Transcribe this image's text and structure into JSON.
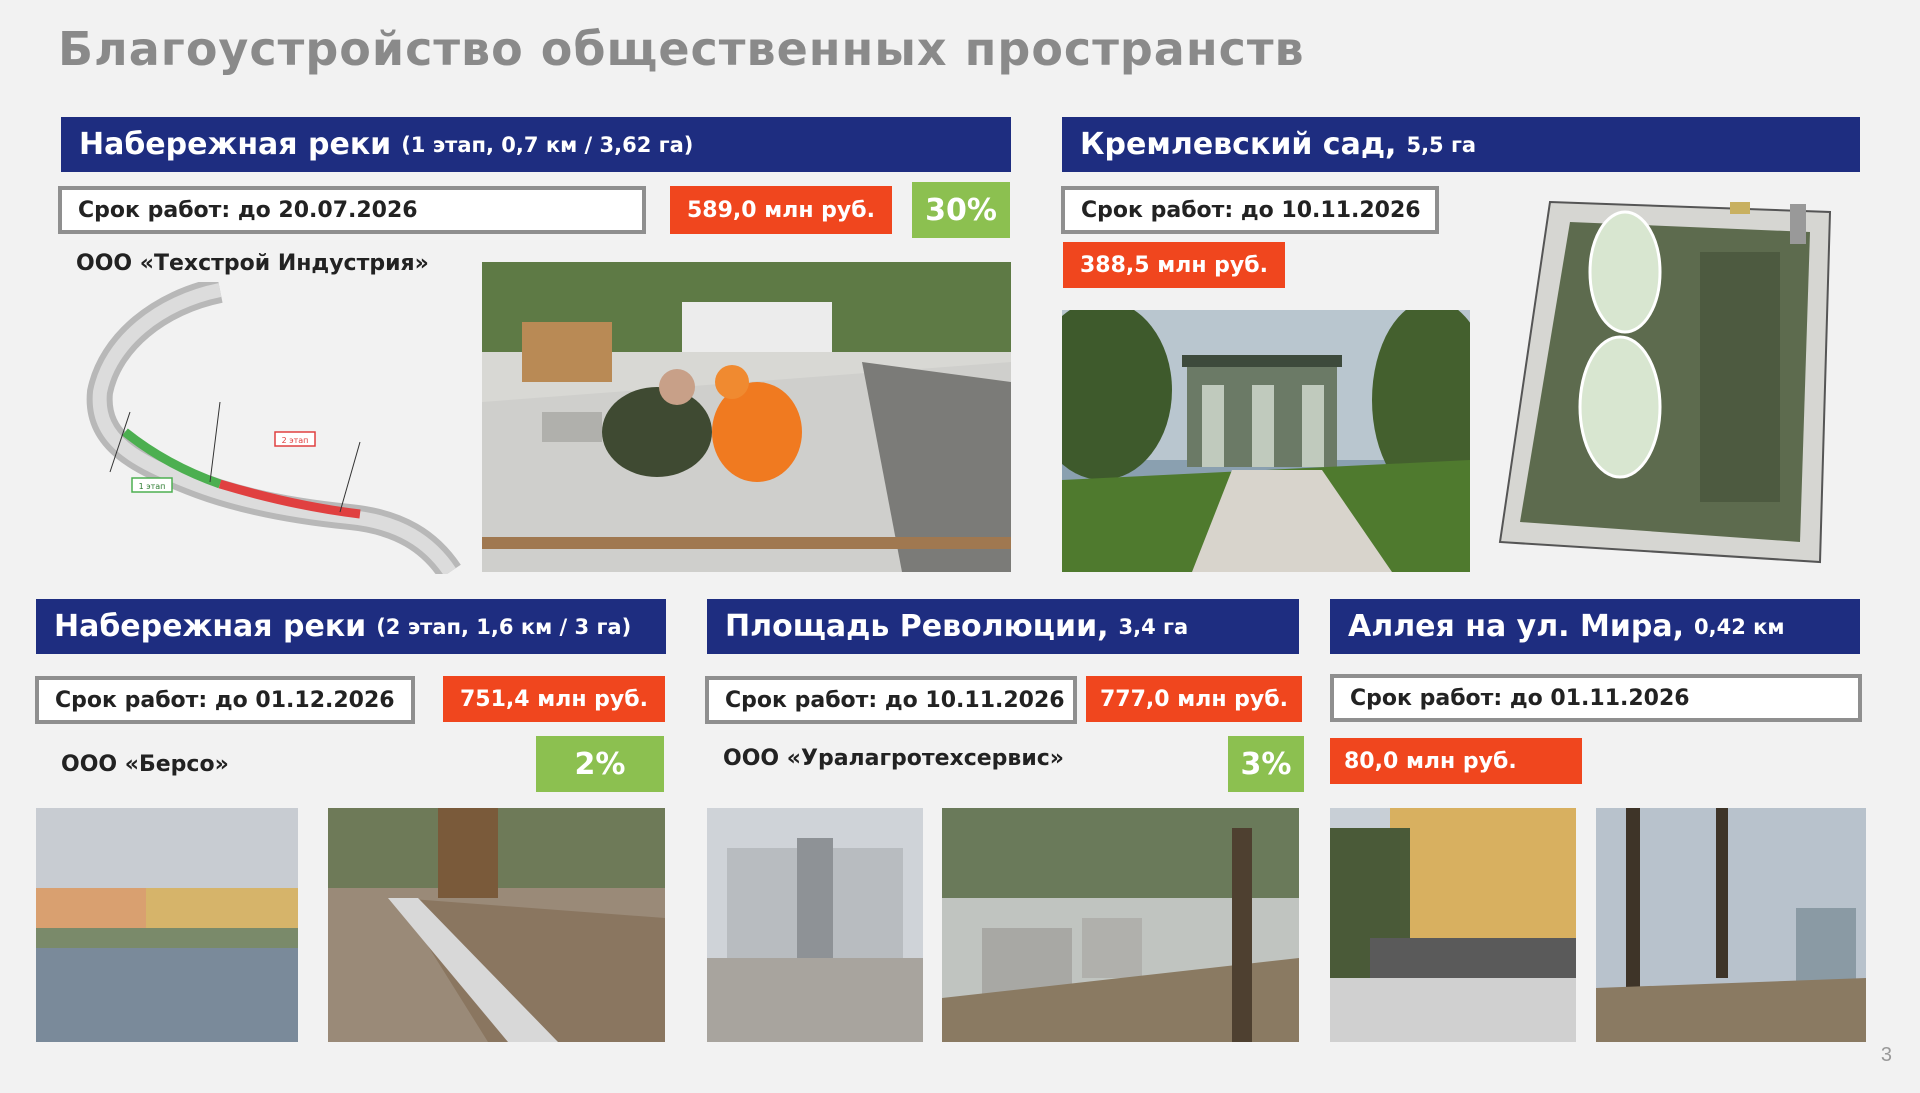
{
  "slide": {
    "title": "Благоустройство общественных пространств",
    "page_number": "3"
  },
  "colors": {
    "header_bg": "#1e2d80",
    "price_bg": "#f0461e",
    "percent_bg": "#8cc050",
    "title_text": "#8a8a8a"
  },
  "projects": [
    {
      "name": "Набережная реки",
      "details": "(1 этап, 0,7 км / 3,62 га)",
      "term": "Срок работ: до 20.07.2026",
      "price": "589,0 млн руб.",
      "progress": "30%",
      "contractor": "ООО «Техстрой Индустрия»"
    },
    {
      "name": "Кремлевский сад,",
      "details": "5,5 га",
      "term": "Срок работ: до 10.11.2026",
      "price": "388,5 млн руб."
    },
    {
      "name": "Набережная реки",
      "details": "(2 этап, 1,6 км / 3 га)",
      "term": "Срок работ: до 01.12.2026",
      "price": "751,4 млн руб.",
      "progress": "2%",
      "contractor": "ООО «Берсо»"
    },
    {
      "name": "Площадь Революции,",
      "details": "3,4 га",
      "term": "Срок работ: до 10.11.2026",
      "price": "777,0 млн руб.",
      "progress": "3%",
      "contractor": "ООО «Уралагротехсервис»"
    },
    {
      "name": "Аллея на ул. Мира,",
      "details": "0,42 км",
      "term": "Срок работ: до 01.11.2026",
      "price": "80,0 млн руб."
    }
  ],
  "map_labels": {
    "stage1": "1 этап",
    "stage2": "2 этап"
  }
}
